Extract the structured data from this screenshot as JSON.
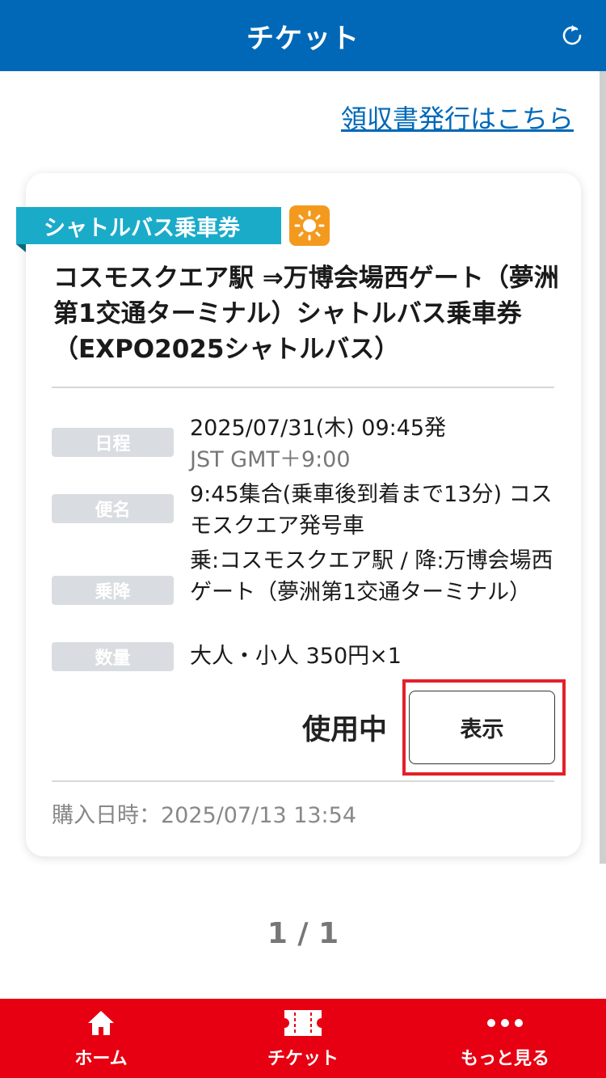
{
  "header": {
    "title": "チケット",
    "refresh_icon": "refresh-icon"
  },
  "receipt_link": "領収書発行はこちら",
  "ticket": {
    "tag": "シャトルバス乗車券",
    "weather_icon": "sun-icon",
    "title": "コスモスクエア駅 ⇒万博会場西ゲート（夢洲第1交通ターミナル）シャトルバス乗車券（EXPO2025シャトルバス）",
    "details": [
      {
        "label": "日程",
        "value": "2025/07/31(木) 09:45発",
        "sub": "JST GMT＋9:00"
      },
      {
        "label": "便名",
        "value": "9:45集合(乗車後到着まで13分) コスモスクエア発号車"
      },
      {
        "label": "乗降",
        "value": "乗:コスモスクエア駅 / 降:万博会場西ゲート（夢洲第1交通ターミナル）"
      },
      {
        "label": "数量",
        "value": "大人・小人 350円×1"
      }
    ],
    "status": "使用中",
    "show_button": "表示",
    "purchase_date": "購入日時：2025/07/13 13:54"
  },
  "pager": "1 / 1",
  "bottom_nav": [
    {
      "label": "ホーム",
      "icon": "home-icon"
    },
    {
      "label": "チケット",
      "icon": "ticket-icon"
    },
    {
      "label": "もっと見る",
      "icon": "more-icon"
    }
  ],
  "colors": {
    "header": "#0068b7",
    "tag": "#1aabc9",
    "nav": "#e60012",
    "highlight": "#e3202a"
  }
}
